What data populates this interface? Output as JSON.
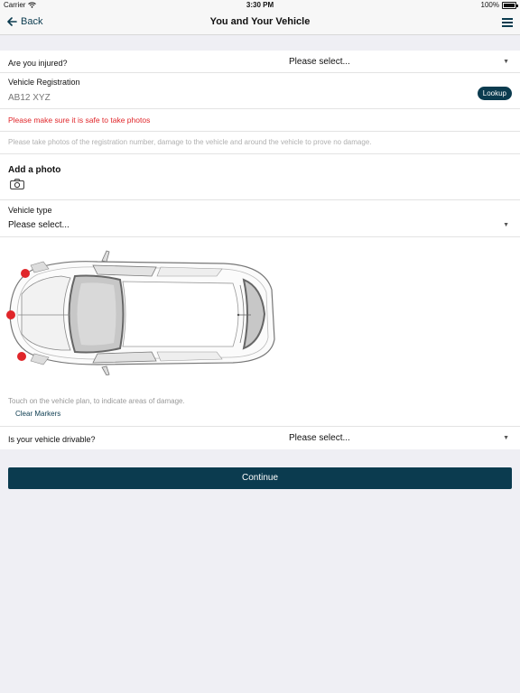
{
  "status_bar": {
    "carrier": "Carrier",
    "time": "3:30 PM",
    "battery": "100%"
  },
  "nav": {
    "back_label": "Back",
    "title": "You and Your Vehicle"
  },
  "injured": {
    "label": "Are you injured?",
    "value": "Please select..."
  },
  "registration": {
    "label": "Vehicle Registration",
    "placeholder": "AB12 XYZ",
    "lookup_label": "Lookup"
  },
  "safety_warning": "Please make sure it is safe to take photos",
  "photo_instructions": "Please take photos of the registration number, damage to the vehicle and around the vehicle to prove no damage.",
  "add_photo": {
    "label": "Add a photo",
    "icon": "camera-icon"
  },
  "vehicle_type": {
    "label": "Vehicle type",
    "value": "Please select..."
  },
  "vehicle_plan": {
    "hint": "Touch on the vehicle plan, to indicate areas of damage.",
    "clear_label": "Clear Markers",
    "marker_color": "#e0262a"
  },
  "drivable": {
    "label": "Is your vehicle drivable?",
    "value": "Please select..."
  },
  "continue_label": "Continue",
  "colors": {
    "accent": "#0b3b4f",
    "warning": "#e0262a",
    "background": "#efeff4"
  }
}
